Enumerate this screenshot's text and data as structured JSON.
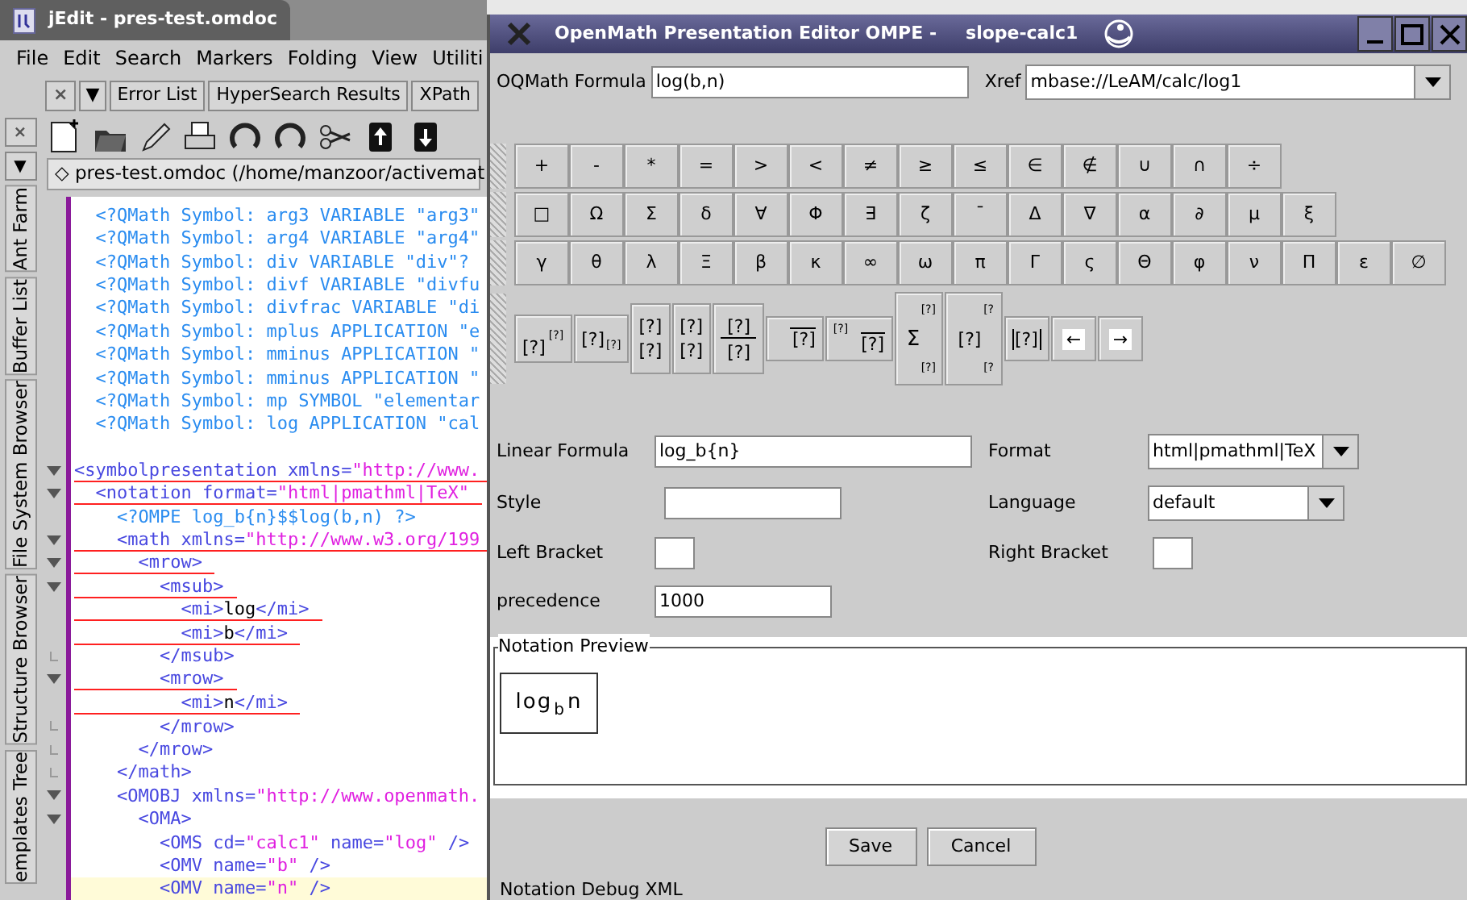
{
  "editor": {
    "title": "jEdit - pres-test.omdoc",
    "menu": [
      "File",
      "Edit",
      "Search",
      "Markers",
      "Folding",
      "View",
      "Utiliti"
    ],
    "dock_tabs": [
      {
        "kind": "close",
        "label": "×"
      },
      {
        "kind": "menu",
        "label": "▼"
      },
      {
        "kind": "tab",
        "label": "Error List"
      },
      {
        "kind": "tab",
        "label": "HyperSearch Results"
      },
      {
        "kind": "tab",
        "label": "XPath"
      }
    ],
    "side_buttons": [
      "×",
      "▼"
    ],
    "side_tabs": [
      "Ant Farm",
      "Buffer List",
      "File System Browser",
      "Structure Browser",
      "emplates Tree"
    ],
    "buffer_path": "◇ pres-test.omdoc (/home/manzoor/activemat",
    "lines": [
      {
        "underline": false,
        "current": false,
        "tokens": [
          {
            "kind": "pi",
            "text": "  <?QMath Symbol: arg3 VARIABLE \"arg3\""
          }
        ]
      },
      {
        "underline": false,
        "current": false,
        "tokens": [
          {
            "kind": "pi",
            "text": "  <?QMath Symbol: arg4 VARIABLE \"arg4\""
          }
        ]
      },
      {
        "underline": false,
        "current": false,
        "tokens": [
          {
            "kind": "pi",
            "text": "  <?QMath Symbol: div VARIABLE \"div\"?"
          }
        ]
      },
      {
        "underline": false,
        "current": false,
        "tokens": [
          {
            "kind": "pi",
            "text": "  <?QMath Symbol: divf VARIABLE \"divfu"
          }
        ]
      },
      {
        "underline": false,
        "current": false,
        "tokens": [
          {
            "kind": "pi",
            "text": "  <?QMath Symbol: divfrac VARIABLE \"di"
          }
        ]
      },
      {
        "underline": false,
        "current": false,
        "tokens": [
          {
            "kind": "pi",
            "text": "  <?QMath Symbol: mplus APPLICATION \"e"
          }
        ]
      },
      {
        "underline": false,
        "current": false,
        "tokens": [
          {
            "kind": "pi",
            "text": "  <?QMath Symbol: mminus APPLICATION \""
          }
        ]
      },
      {
        "underline": false,
        "current": false,
        "tokens": [
          {
            "kind": "pi",
            "text": "  <?QMath Symbol: mminus APPLICATION \""
          }
        ]
      },
      {
        "underline": false,
        "current": false,
        "tokens": [
          {
            "kind": "pi",
            "text": "  <?QMath Symbol: mp SYMBOL \"elementar"
          }
        ]
      },
      {
        "underline": false,
        "current": false,
        "tokens": [
          {
            "kind": "pi",
            "text": "  <?QMath Symbol: log APPLICATION \"cal"
          }
        ]
      },
      {
        "blank_before": true,
        "foldable": true,
        "underline": true,
        "current": false,
        "tokens": [
          {
            "kind": "tag",
            "text": "<symbolpresentation xmlns="
          },
          {
            "kind": "string",
            "text": "\"http://www."
          }
        ]
      },
      {
        "foldable": true,
        "underline": true,
        "current": false,
        "tokens": [
          {
            "kind": "tag",
            "text": "  <notation format="
          },
          {
            "kind": "string",
            "text": "\"html|pmathml|TeX\""
          }
        ]
      },
      {
        "underline": false,
        "current": false,
        "tokens": [
          {
            "kind": "pi",
            "text": "    <?OMPE log_b{n}$$log(b,n) ?>"
          }
        ]
      },
      {
        "foldable": true,
        "underline": true,
        "current": false,
        "tokens": [
          {
            "kind": "tag",
            "text": "    <math xmlns="
          },
          {
            "kind": "string",
            "text": "\"http://www.w3.org/199"
          }
        ]
      },
      {
        "foldable": true,
        "underline": true,
        "current": false,
        "tokens": [
          {
            "kind": "tag",
            "text": "      <mrow>"
          }
        ]
      },
      {
        "foldable": true,
        "underline": true,
        "current": false,
        "tokens": [
          {
            "kind": "tag",
            "text": "        <msub>"
          }
        ]
      },
      {
        "underline": true,
        "current": false,
        "tokens": [
          {
            "kind": "tag",
            "text": "          <mi>"
          },
          {
            "kind": "text",
            "text": "log"
          },
          {
            "kind": "tag",
            "text": "</mi>"
          }
        ]
      },
      {
        "underline": true,
        "current": false,
        "tokens": [
          {
            "kind": "tag",
            "text": "          <mi>"
          },
          {
            "kind": "text",
            "text": "b"
          },
          {
            "kind": "tag",
            "text": "</mi>"
          }
        ]
      },
      {
        "fold_end": true,
        "underline": false,
        "current": false,
        "tokens": [
          {
            "kind": "tag",
            "text": "        </msub>"
          }
        ]
      },
      {
        "foldable": true,
        "underline": true,
        "current": false,
        "tokens": [
          {
            "kind": "tag",
            "text": "        <mrow>"
          }
        ]
      },
      {
        "underline": true,
        "current": false,
        "tokens": [
          {
            "kind": "tag",
            "text": "          <mi>"
          },
          {
            "kind": "text",
            "text": "n"
          },
          {
            "kind": "tag",
            "text": "</mi>"
          }
        ]
      },
      {
        "fold_end": true,
        "underline": false,
        "current": false,
        "tokens": [
          {
            "kind": "tag",
            "text": "        </mrow>"
          }
        ]
      },
      {
        "fold_end": true,
        "underline": false,
        "current": false,
        "tokens": [
          {
            "kind": "tag",
            "text": "      </mrow>"
          }
        ]
      },
      {
        "fold_end": true,
        "underline": false,
        "current": false,
        "tokens": [
          {
            "kind": "tag",
            "text": "    </math>"
          }
        ]
      },
      {
        "foldable": true,
        "underline": false,
        "current": false,
        "tokens": [
          {
            "kind": "tag",
            "text": "    <OMOBJ xmlns="
          },
          {
            "kind": "string",
            "text": "\"http://www.openmath."
          }
        ]
      },
      {
        "foldable": true,
        "underline": false,
        "current": false,
        "tokens": [
          {
            "kind": "tag",
            "text": "      <OMA>"
          }
        ]
      },
      {
        "underline": false,
        "current": false,
        "tokens": [
          {
            "kind": "tag",
            "text": "        <OMS cd="
          },
          {
            "kind": "string",
            "text": "\"calc1\""
          },
          {
            "kind": "tag",
            "text": " name="
          },
          {
            "kind": "string",
            "text": "\"log\""
          },
          {
            "kind": "tag",
            "text": " />"
          }
        ]
      },
      {
        "underline": false,
        "current": false,
        "tokens": [
          {
            "kind": "tag",
            "text": "        <OMV name="
          },
          {
            "kind": "string",
            "text": "\"b\""
          },
          {
            "kind": "tag",
            "text": " />"
          }
        ]
      },
      {
        "underline": false,
        "current": true,
        "tokens": [
          {
            "kind": "tag",
            "text": "        <OMV name="
          },
          {
            "kind": "string",
            "text": "\"n\""
          },
          {
            "kind": "tag",
            "text": " />"
          }
        ]
      }
    ]
  },
  "dialog": {
    "title": "OpenMath Presentation Editor OMPE -",
    "subtitle": "slope-calc1",
    "formula": {
      "label": "OQMath Formula",
      "value": "log(b,n)"
    },
    "xref": {
      "label": "Xref",
      "value": "mbase://LeAM/calc/log1"
    },
    "palette": [
      [
        "+",
        "-",
        "*",
        "=",
        ">",
        "<",
        "≠",
        "≥",
        "≤",
        "∈",
        "∉",
        "∪",
        "∩",
        "÷"
      ],
      [
        "□",
        "Ω",
        "Σ",
        "δ",
        "∀",
        "Φ",
        "∃",
        "ζ",
        "¯",
        "Δ",
        "∇",
        "α",
        "∂",
        "μ",
        "ξ"
      ],
      [
        "γ",
        "θ",
        "λ",
        "Ξ",
        "β",
        "κ",
        "∞",
        "ω",
        "π",
        "Γ",
        "ς",
        "Θ",
        "φ",
        "ν",
        "Π",
        "ε",
        "∅"
      ]
    ],
    "templates": [
      {
        "kind": "sup",
        "main": "[?]",
        "upper": "[?]"
      },
      {
        "kind": "sub",
        "main": "[?]",
        "lower": "[?]"
      },
      {
        "kind": "stack",
        "upper": "[?]",
        "lower": "[?]"
      },
      {
        "kind": "stack",
        "upper": "[?]",
        "lower": "[?]"
      },
      {
        "kind": "frac",
        "upper": "[?]",
        "lower": "[?]"
      },
      {
        "kind": "sqrt",
        "main": "[?]"
      },
      {
        "kind": "root",
        "main": "[?]",
        "upper": "[?]"
      },
      {
        "kind": "sum",
        "main": "Σ",
        "upper": "[?]",
        "lower": "[?]"
      },
      {
        "kind": "scripts",
        "main": "[?]",
        "upper": "[?",
        "lower": "[?"
      },
      {
        "kind": "abs",
        "main": "[?]"
      },
      {
        "kind": "arrow",
        "main": "←"
      },
      {
        "kind": "arrow",
        "main": "→"
      }
    ],
    "fields": [
      {
        "kind": "text",
        "label": "Linear Formula",
        "value": "log_b{n}"
      },
      {
        "kind": "combo",
        "label": "Format",
        "value": "html|pmathml|TeX"
      },
      {
        "kind": "text",
        "label": "Style"
      },
      {
        "kind": "combo",
        "label": "Language",
        "value": "default"
      },
      {
        "kind": "text",
        "label": "Left Bracket"
      },
      {
        "kind": "text",
        "label": "Right Bracket"
      },
      {
        "kind": "text",
        "label": "precedence",
        "value": "1000"
      }
    ],
    "preview": {
      "title": "Notation Preview",
      "base": "log",
      "sub": "b",
      "arg": "n"
    },
    "buttons": [
      "Save",
      "Cancel"
    ],
    "debug_label": "Notation Debug XML"
  }
}
